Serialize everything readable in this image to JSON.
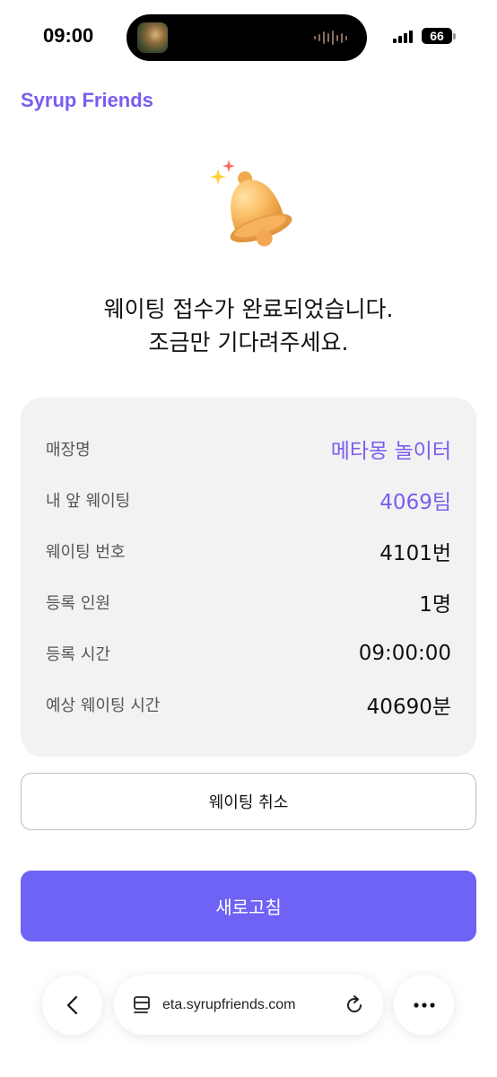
{
  "status_bar": {
    "time": "09:00",
    "battery": "66"
  },
  "header": {
    "brand": "Syrup Friends"
  },
  "headline": {
    "line1": "웨이팅 접수가 완료되었습니다.",
    "line2": "조금만 기다려주세요."
  },
  "info": {
    "rows": [
      {
        "label": "매장명",
        "value": "메타몽 놀이터",
        "accent": true
      },
      {
        "label": "내 앞 웨이팅",
        "value": "4069팀",
        "accent": true
      },
      {
        "label": "웨이팅 번호",
        "value": "4101번",
        "accent": false
      },
      {
        "label": "등록 인원",
        "value": "1명",
        "accent": false
      },
      {
        "label": "등록 시간",
        "value": "09:00:00",
        "accent": false
      },
      {
        "label": "예상 웨이팅 시간",
        "value": "40690분",
        "accent": false
      }
    ]
  },
  "buttons": {
    "cancel": "웨이팅 취소",
    "refresh": "새로고침"
  },
  "browser": {
    "url": "eta.syrupfriends.com",
    "icons": {
      "back": "chevron-left-icon",
      "page": "page-menu-icon",
      "reload": "reload-icon",
      "more": "more-icon"
    }
  },
  "colors": {
    "brand": "#7a5cf0",
    "primary_button": "#6e63f4",
    "card_bg": "#f2f2f2"
  }
}
